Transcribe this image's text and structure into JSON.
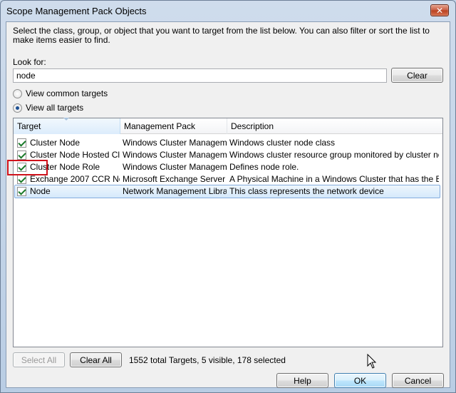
{
  "window": {
    "title": "Scope Management Pack Objects",
    "close_glyph": "✕"
  },
  "instructions": "Select the class, group, or object that you want to target from the list below. You can also filter or sort the list to make items easier to find.",
  "search": {
    "label": "Look for:",
    "value": "node",
    "clear_label": "Clear"
  },
  "radios": [
    {
      "label": "View common targets",
      "checked": false
    },
    {
      "label": "View all targets",
      "checked": true
    }
  ],
  "grid": {
    "columns": [
      "Target",
      "Management Pack",
      "Description"
    ],
    "rows": [
      {
        "checked": true,
        "target": "Cluster Node",
        "pack": "Windows Cluster Manageme",
        "description": "Windows cluster node class"
      },
      {
        "checked": true,
        "target": "Cluster Node Hosted Clu",
        "pack": "Windows Cluster Manageme",
        "description": "Windows cluster resource group monitored by cluster nod"
      },
      {
        "checked": true,
        "target": "Cluster Node Role",
        "pack": "Windows Cluster Manageme",
        "description": "Defines node role."
      },
      {
        "checked": true,
        "target": "Exchange 2007 CCR Nod",
        "pack": "Microsoft Exchange Server 2",
        "description": "A Physical Machine in a Windows Cluster that has the Exch"
      },
      {
        "checked": true,
        "target": "Node",
        "pack": "Network Management Librar",
        "description": "This class represents the network device",
        "selected": true
      }
    ]
  },
  "footer": {
    "select_all_label": "Select All",
    "clear_all_label": "Clear All",
    "status": "1552 total Targets, 5 visible, 178 selected",
    "help_label": "Help",
    "ok_label": "OK",
    "cancel_label": "Cancel"
  },
  "colors": {
    "highlight_box": "#d0121b",
    "selection": "#d5e9fb",
    "check": "#1a7a2a"
  }
}
